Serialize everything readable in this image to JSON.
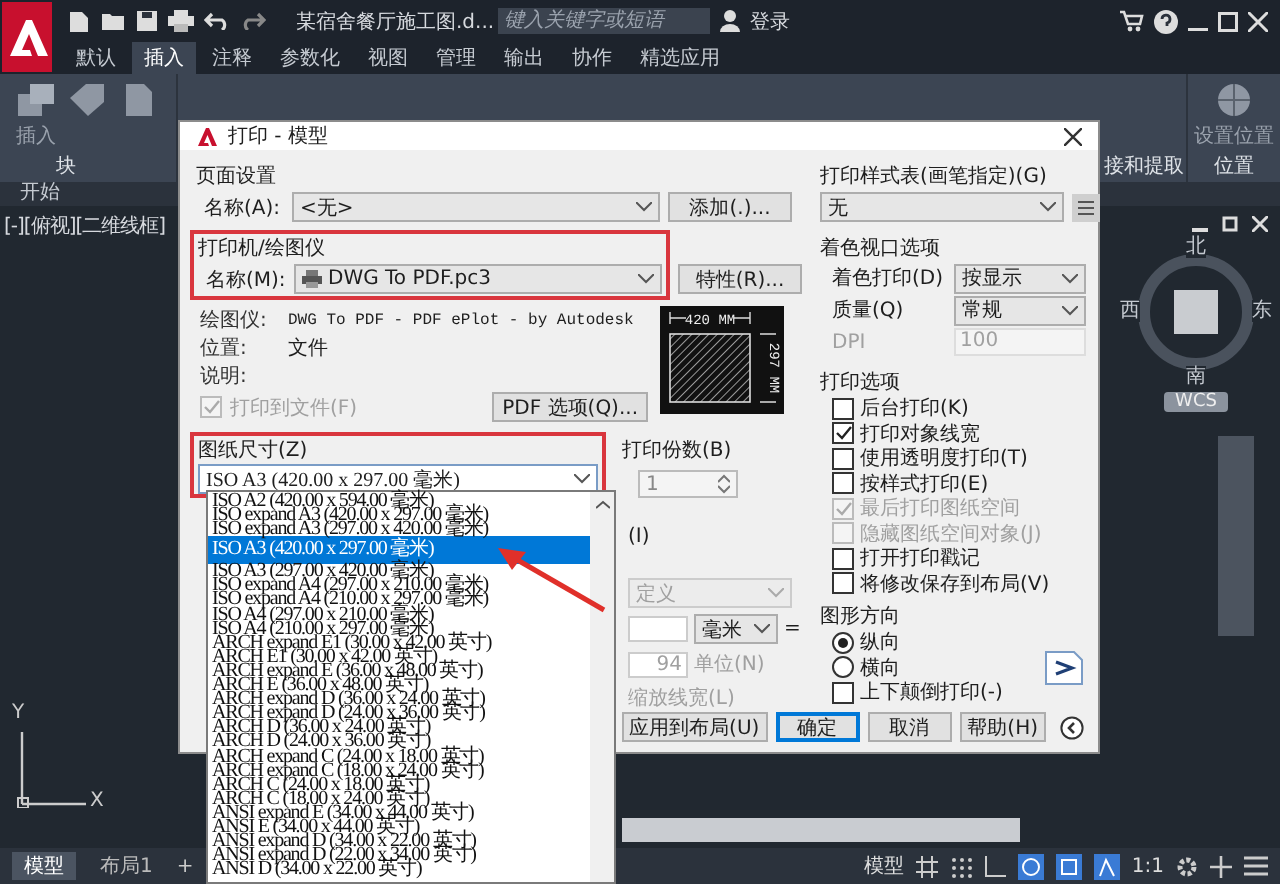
{
  "app": {
    "title": "某宿舍餐厅施工图.d...",
    "search": {
      "placeholder": "键入关键字或短语"
    },
    "user": "登录",
    "ribbon_tabs": [
      {
        "label": "默认",
        "selected": false
      },
      {
        "label": "插入",
        "selected": true
      },
      {
        "label": "注释",
        "selected": false
      },
      {
        "label": "参数化",
        "selected": false
      },
      {
        "label": "视图",
        "selected": false
      },
      {
        "label": "管理",
        "selected": false
      },
      {
        "label": "输出",
        "selected": false
      },
      {
        "label": "协作",
        "selected": false
      },
      {
        "label": "精选应用",
        "selected": false
      }
    ],
    "ribbon_panel": {
      "insert_label": "插入",
      "block_panel": "块",
      "link_panel": "接和提取",
      "location_tool": "设置位置",
      "location_panel": "位置"
    },
    "file_tab": "开始",
    "viewport_label": "[-][俯视][二维线框]",
    "viewcube": {
      "north": "北",
      "east": "东",
      "south": "南",
      "west": "西",
      "ucs": "WCS"
    },
    "axis": {
      "x": "X",
      "y": "Y"
    },
    "layout_tabs": [
      {
        "label": "模型",
        "selected": true
      },
      {
        "label": "布局1",
        "selected": false
      }
    ],
    "add_layout": "+",
    "status_bar": {
      "space": "模型",
      "scale": "1:1"
    }
  },
  "dialog": {
    "title": "打印 - 模型",
    "page_setup": {
      "heading": "页面设置",
      "name_label": "名称(A):",
      "name_value": "<无>",
      "add_button": "添加(.)..."
    },
    "printer": {
      "heading": "打印机/绘图仪",
      "highlighted": true,
      "name_label": "名称(M):",
      "name_value": "DWG To PDF.pc3",
      "properties_button": "特性(R)...",
      "plotter_label": "绘图仪:",
      "plotter_value": "DWG To PDF - PDF ePlot - by Autodesk",
      "location_label": "位置:",
      "location_value": "文件",
      "description_label": "说明:",
      "plot_to_file": {
        "label": "打印到文件(F)",
        "checked": true,
        "disabled": true
      },
      "pdf_options_button": "PDF 选项(Q)...",
      "preview": {
        "width": "420 MM",
        "height": "297 MM"
      }
    },
    "paper_size": {
      "heading": "图纸尺寸(Z)",
      "highlighted": true,
      "value": "ISO A3 (420.00 x 297.00 毫米)",
      "expanded": true,
      "options": [
        {
          "label": "ISO A2 (420.00 x 594.00 毫米)",
          "selected": false
        },
        {
          "label": "ISO expand A3 (420.00 x 297.00 毫米)",
          "selected": false
        },
        {
          "label": "ISO expand A3 (297.00 x 420.00 毫米)",
          "selected": false
        },
        {
          "label": "ISO A3 (420.00 x 297.00 毫米)",
          "selected": true
        },
        {
          "label": "ISO A3 (297.00 x 420.00 毫米)",
          "selected": false
        },
        {
          "label": "ISO expand A4 (297.00 x 210.00 毫米)",
          "selected": false
        },
        {
          "label": "ISO expand A4 (210.00 x 297.00 毫米)",
          "selected": false
        },
        {
          "label": "ISO A4 (297.00 x 210.00 毫米)",
          "selected": false
        },
        {
          "label": "ISO A4 (210.00 x 297.00 毫米)",
          "selected": false
        },
        {
          "label": "ARCH expand E1 (30.00 x 42.00 英寸)",
          "selected": false
        },
        {
          "label": "ARCH E1 (30.00 x 42.00 英寸)",
          "selected": false
        },
        {
          "label": "ARCH expand E (36.00 x 48.00 英寸)",
          "selected": false
        },
        {
          "label": "ARCH E (36.00 x 48.00 英寸)",
          "selected": false
        },
        {
          "label": "ARCH expand D (36.00 x 24.00 英寸)",
          "selected": false
        },
        {
          "label": "ARCH expand D (24.00 x 36.00 英寸)",
          "selected": false
        },
        {
          "label": "ARCH D (36.00 x 24.00 英寸)",
          "selected": false
        },
        {
          "label": "ARCH D (24.00 x 36.00 英寸)",
          "selected": false
        },
        {
          "label": "ARCH expand C (24.00 x 18.00 英寸)",
          "selected": false
        },
        {
          "label": "ARCH expand C (18.00 x 24.00 英寸)",
          "selected": false
        },
        {
          "label": "ARCH C (24.00 x 18.00 英寸)",
          "selected": false
        },
        {
          "label": "ARCH C (18.00 x 24.00 英寸)",
          "selected": false
        },
        {
          "label": "ANSI expand E (34.00 x 44.00 英寸)",
          "selected": false
        },
        {
          "label": "ANSI E (34.00 x 44.00 英寸)",
          "selected": false
        },
        {
          "label": "ANSI expand D (34.00 x 22.00 英寸)",
          "selected": false
        },
        {
          "label": "ANSI expand D (22.00 x 34.00 英寸)",
          "selected": false
        },
        {
          "label": "ANSI D (34.00 x 22.00 英寸)",
          "selected": false
        }
      ]
    },
    "copies": {
      "label": "打印份数(B)",
      "value": "1"
    },
    "covered": {
      "plot_area_hint": "(I)",
      "area_value": "定义",
      "unit_value": "毫米",
      "equals_sign": "=",
      "unit_number": "94",
      "unit_label": "单位(N)",
      "scale_lineweights": "缩放线宽(L)"
    },
    "plot_style_table": {
      "heading": "打印样式表(画笔指定)(G)",
      "value": "无"
    },
    "shaded_viewport": {
      "heading": "着色视口选项",
      "shade_label": "着色打印(D)",
      "shade_value": "按显示",
      "quality_label": "质量(Q)",
      "quality_value": "常规",
      "dpi_label": "DPI",
      "dpi_value": "100"
    },
    "plot_options": {
      "heading": "打印选项",
      "items": [
        {
          "label": "后台打印(K)",
          "checked": false,
          "disabled": false
        },
        {
          "label": "打印对象线宽",
          "checked": true,
          "disabled": false
        },
        {
          "label": "使用透明度打印(T)",
          "checked": false,
          "disabled": false
        },
        {
          "label": "按样式打印(E)",
          "checked": false,
          "disabled": false
        },
        {
          "label": "最后打印图纸空间",
          "checked": true,
          "disabled": true
        },
        {
          "label": "隐藏图纸空间对象(J)",
          "checked": false,
          "disabled": true
        },
        {
          "label": "打开打印戳记",
          "checked": false,
          "disabled": false
        },
        {
          "label": "将修改保存到布局(V)",
          "checked": false,
          "disabled": false
        }
      ]
    },
    "orientation": {
      "heading": "图形方向",
      "options": [
        {
          "label": "纵向",
          "selected": true
        },
        {
          "label": "横向",
          "selected": false
        }
      ],
      "upside_down": {
        "label": "上下颠倒打印(-)",
        "checked": false
      }
    },
    "buttons": [
      {
        "label": "应用到布局(U)",
        "default": false
      },
      {
        "label": "确定",
        "default": true
      },
      {
        "label": "取消",
        "default": false
      },
      {
        "label": "帮助(H)",
        "default": false
      }
    ]
  }
}
